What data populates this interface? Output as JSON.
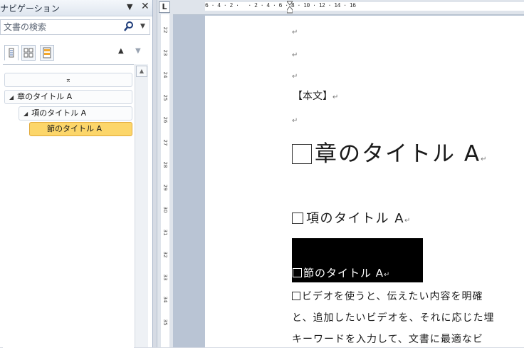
{
  "nav_pane": {
    "title": "ナビゲーション",
    "menu_glyph": "▼",
    "close_glyph": "✕",
    "search_placeholder": "文書の検索",
    "up_glyph": "▲",
    "down_glyph": "▼",
    "tree": [
      {
        "label": "",
        "glyph": "⌅"
      },
      {
        "label": "章のタイトル A",
        "level": 1,
        "expanded": true
      },
      {
        "label": "項のタイトル A",
        "level": 2,
        "expanded": true
      },
      {
        "label": "節のタイトル A",
        "level": 3,
        "selected": true
      }
    ],
    "selected_color": "#fcd66a"
  },
  "ruler": {
    "corner_glyph": "L",
    "horizontal_numbers": "6 · 4 · 2 ·   · 2 · 4 · 6 · 8 · 10 · 12 · 14 · 16",
    "vertical_numbers": [
      "22",
      "23",
      "24",
      "25",
      "26",
      "27",
      "28",
      "29",
      "30",
      "31",
      "32",
      "33",
      "34",
      "35"
    ]
  },
  "document": {
    "para_mark": "↵",
    "honbun": "【本文】",
    "heading1": "章のタイトル A",
    "heading2": "項のタイトル A",
    "heading3": "節のタイトル A",
    "body_line1": "ビデオを使うと、伝えたい内容を明確",
    "body_line2": "と、追加したいビデオを、それに応じた埋",
    "body_line3": "キーワードを入力して、文書に最適なビ"
  }
}
